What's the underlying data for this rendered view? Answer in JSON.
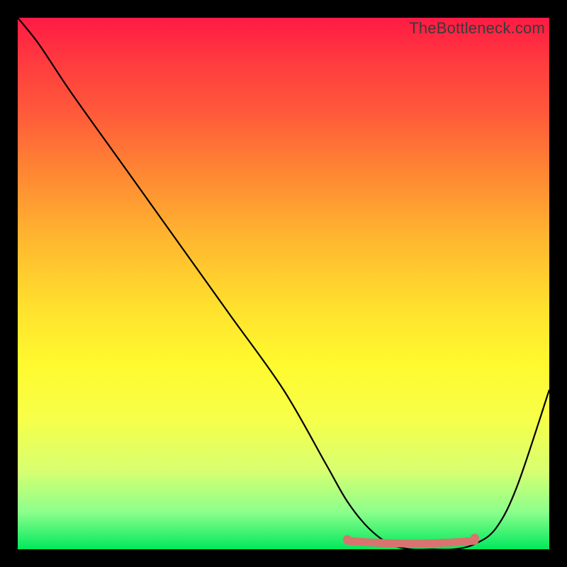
{
  "watermark": "TheBottleneck.com",
  "colors": {
    "gradient_top": "#ff1a44",
    "gradient_mid": "#ffe22e",
    "gradient_bottom": "#00e85c",
    "curve": "#000000",
    "marker": "#d8736f",
    "frame_bg": "#000000"
  },
  "chart_data": {
    "type": "line",
    "title": "",
    "xlabel": "",
    "ylabel": "",
    "xlim": [
      0,
      100
    ],
    "ylim": [
      0,
      100
    ],
    "grid": false,
    "series": [
      {
        "name": "bottleneck-curve",
        "x": [
          0,
          4,
          10,
          20,
          30,
          40,
          50,
          58,
          62,
          66,
          70,
          74,
          78,
          82,
          86,
          90,
          94,
          100
        ],
        "y": [
          100,
          95,
          86,
          72,
          58,
          44,
          30,
          16,
          9,
          4,
          1,
          0,
          0,
          0,
          1,
          4,
          12,
          30
        ]
      }
    ],
    "markers": {
      "name": "highlight-range",
      "x_start": 62,
      "x_end": 86,
      "y": 0
    },
    "notes": "Y expressed as percentage of plot height from the bottom (0 = bottom edge). X as percentage of plot width from the left edge."
  }
}
